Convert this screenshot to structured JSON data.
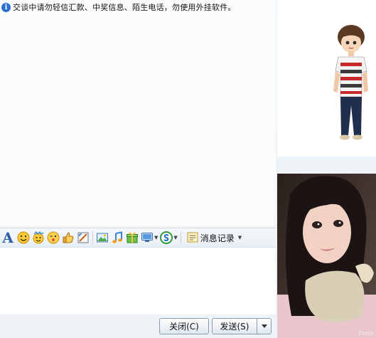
{
  "notice": {
    "text": "交谈中请勿轻信汇款、中奖信息、陌生电话，勿使用外挂软件。",
    "info_icon": "i"
  },
  "toolbar": {
    "font_label": "A",
    "history_label": "消息记录",
    "icons": [
      "font-icon",
      "smiley-face-icon",
      "magic-face-icon",
      "wink-face-icon",
      "thumbs-up-icon",
      "screenshot-icon",
      "image-icon",
      "music-note-icon",
      "gift-box-icon",
      "screen-share-icon",
      "soso-icon",
      "message-history-icon"
    ]
  },
  "buttons": {
    "close": "关闭(C)",
    "send": "发送(S)"
  },
  "photo_watermark": "Prois",
  "colors": {
    "accent": "#2b6fd0",
    "panel_bg": "#eef3f8"
  }
}
